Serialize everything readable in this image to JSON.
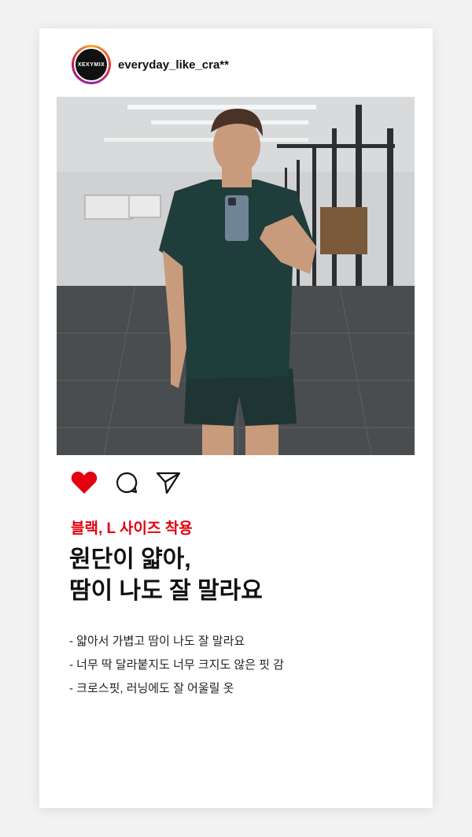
{
  "post": {
    "username": "everyday_like_cra**",
    "avatar_text": "XEXYMIX",
    "caption_tag": "블랙, L 사이즈 착용",
    "headline": [
      "원단이 얇아,",
      "땀이 나도 잘 말라요"
    ],
    "bullets": [
      "- 얇아서 가볍고 땀이 나도 잘 말라요",
      "- 너무 딱 달라붙지도 너무 크지도 않은 핏 감",
      "- 크로스핏, 러닝에도 잘 어울릴 옷"
    ]
  },
  "icons": {
    "like": "heart-icon",
    "comment": "comment-icon",
    "share": "send-icon"
  },
  "colors": {
    "accent": "#e3000f",
    "text": "#111111",
    "background": "#f2f2f2",
    "card": "#ffffff"
  }
}
